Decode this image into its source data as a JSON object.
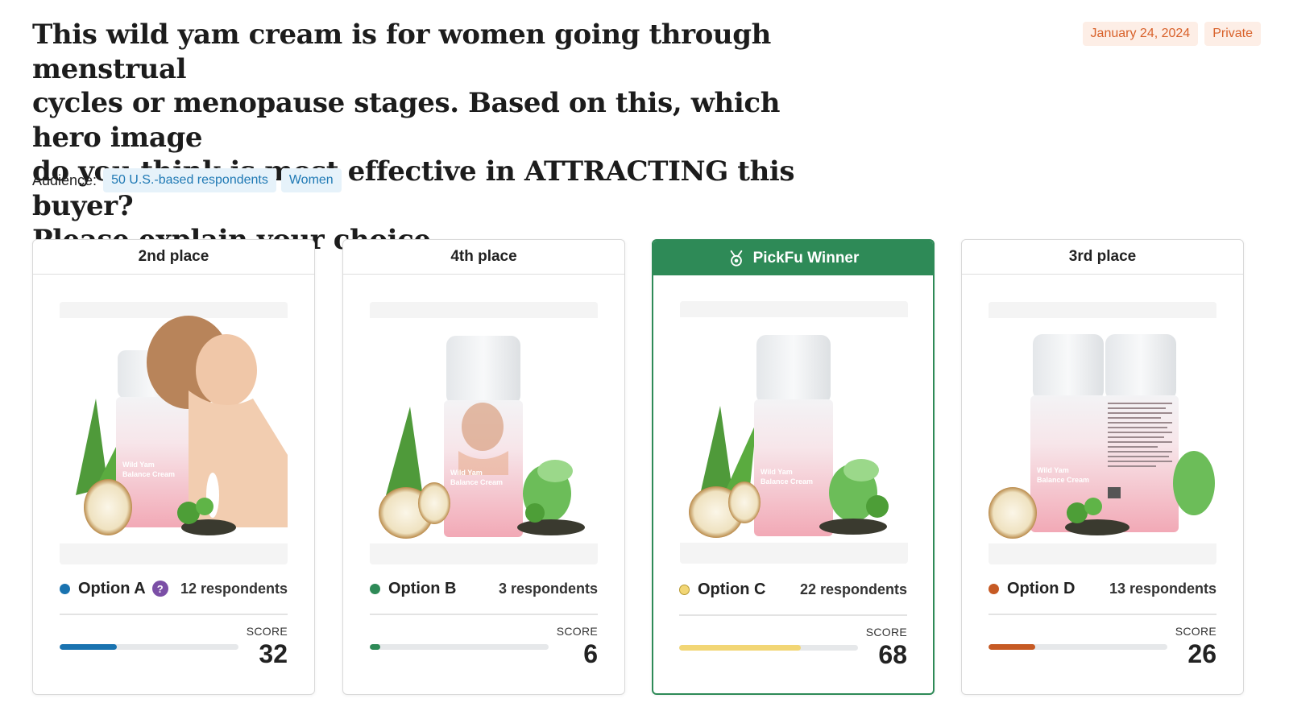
{
  "question": {
    "line1": "This wild yam cream is for women going through menstrual",
    "line2": "cycles or menopause stages. Based on this, which hero image",
    "line3": "do you think is most effective in ATTRACTING this buyer?",
    "line4": "Please explain your choice."
  },
  "meta": {
    "date": "January 24, 2024",
    "visibility": "Private"
  },
  "audience": {
    "label": "Audience:",
    "tags": [
      "50 U.S.-based respondents",
      "Women"
    ]
  },
  "score_label": "SCORE",
  "cards": [
    {
      "place": "2nd place",
      "option": "Option A",
      "respondents": "12 respondents",
      "score": "32",
      "score_fraction": 0.32,
      "color": "#1a73b0",
      "has_help": true,
      "help_glyph": "?",
      "image_icon": "product-with-woman-image"
    },
    {
      "place": "4th place",
      "option": "Option B",
      "respondents": "3 respondents",
      "score": "6",
      "score_fraction": 0.06,
      "color": "#2e8a57",
      "has_help": false,
      "image_icon": "product-with-label-portrait-image"
    },
    {
      "place": "PickFu Winner",
      "option": "Option C",
      "respondents": "22 respondents",
      "score": "68",
      "score_fraction": 0.68,
      "color": "#f2d675",
      "has_help": false,
      "winner": true,
      "image_icon": "product-only-image"
    },
    {
      "place": "3rd place",
      "option": "Option D",
      "respondents": "13 respondents",
      "score": "26",
      "score_fraction": 0.26,
      "color": "#c65a24",
      "has_help": false,
      "image_icon": "product-front-back-image"
    }
  ],
  "product_label": {
    "line1": "Wild Yam",
    "line2": "Balance Cream"
  }
}
